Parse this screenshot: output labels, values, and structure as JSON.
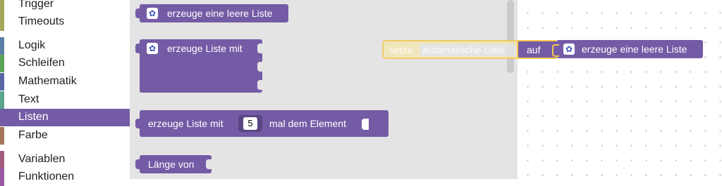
{
  "toolbox": {
    "categories": [
      {
        "label": "Trigger",
        "color": "#a5a55b"
      },
      {
        "label": "Timeouts",
        "color": "#a5a55b"
      },
      {
        "label": "Logik",
        "color": "#5b80a5"
      },
      {
        "label": "Schleifen",
        "color": "#5ba55b"
      },
      {
        "label": "Mathematik",
        "color": "#5b67a5"
      },
      {
        "label": "Text",
        "color": "#5ba58c"
      },
      {
        "label": "Listen",
        "color": "#745ba5"
      },
      {
        "label": "Farbe",
        "color": "#a5745b"
      },
      {
        "label": "Variablen",
        "color": "#a55b80"
      },
      {
        "label": "Funktionen",
        "color": "#995ba5"
      }
    ],
    "selected": "Listen"
  },
  "flyout": {
    "block1_label": "erzeuge eine leere Liste",
    "block2_label": "erzeuge Liste mit",
    "block3_label": "erzeuge Liste mit",
    "block3_count": "5",
    "block3_suffix": "mal dem Element",
    "block4_label": "Länge von",
    "gear_icon": "gear-icon"
  },
  "workspace": {
    "set_label": "setze",
    "set_variable": "automatische Liste",
    "set_to": "auf",
    "value_block_label": "erzeuge eine leere Liste"
  },
  "colors": {
    "list_category": "#745ba5",
    "flyout_bg": "#e4e4e4",
    "highlight": "#f5c84f"
  }
}
